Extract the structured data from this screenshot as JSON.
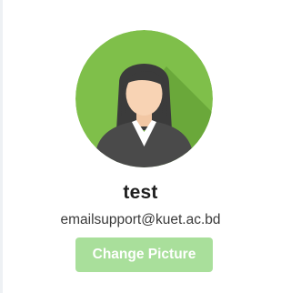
{
  "profile": {
    "name": "test",
    "email": "emailsupport@kuet.ac.bd",
    "avatar_icon": "female-user-avatar-icon"
  },
  "actions": {
    "change_picture_label": "Change Picture"
  },
  "colors": {
    "avatar_bg": "#7fbf4a",
    "avatar_shadow": "#6aa83a",
    "button_bg": "#a9df9b",
    "name_text": "#1e1e1e"
  }
}
